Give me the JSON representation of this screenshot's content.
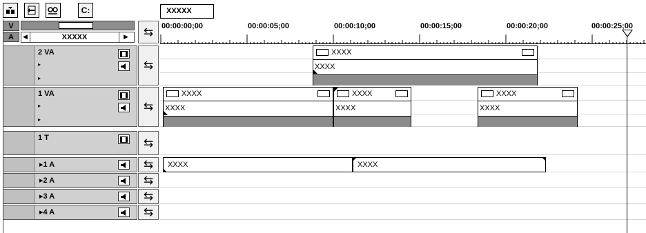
{
  "toolbar": {
    "buttons": [
      {
        "name": "track-settings-button",
        "glyph": "◢"
      },
      {
        "name": "add-track-button",
        "glyph": "⇤"
      },
      {
        "name": "link-button",
        "glyph": "∞"
      },
      {
        "name": "clip-mode-button",
        "glyph": "C:"
      }
    ]
  },
  "sequence_tab": "XXXXX",
  "patch": {
    "video_label": "V",
    "audio_label": "A",
    "selector_value": "XXXXX"
  },
  "ruler": {
    "timecodes": [
      "00:00:00;00",
      "00:00:05;00",
      "00:00:10;00",
      "00:00:15;00",
      "00:00:20;00",
      "00:00:25;00"
    ]
  },
  "tracks": [
    {
      "name": "2 VA",
      "type": "va"
    },
    {
      "name": "1 VA",
      "type": "va"
    },
    {
      "name": "1 T",
      "type": "t"
    },
    {
      "name": "1 A",
      "type": "a"
    },
    {
      "name": "2 A",
      "type": "a"
    },
    {
      "name": "3 A",
      "type": "a"
    },
    {
      "name": "4 A",
      "type": "a"
    }
  ],
  "clips": {
    "track_2va": [
      {
        "title": "XXXX",
        "label": "XXXX"
      }
    ],
    "track_1va": [
      {
        "title": "XXXX",
        "label": "XXXX"
      },
      {
        "title": "XXXX",
        "label": "XXXX"
      },
      {
        "title": "XXXX",
        "label": "XXXX"
      }
    ],
    "track_1a": [
      {
        "label": "XXXX"
      },
      {
        "label": "XXXX"
      }
    ]
  },
  "icons": {
    "sync": "⇆",
    "video_toggle": "film-icon",
    "audio_toggle": "speaker-icon",
    "expand": "▸"
  }
}
